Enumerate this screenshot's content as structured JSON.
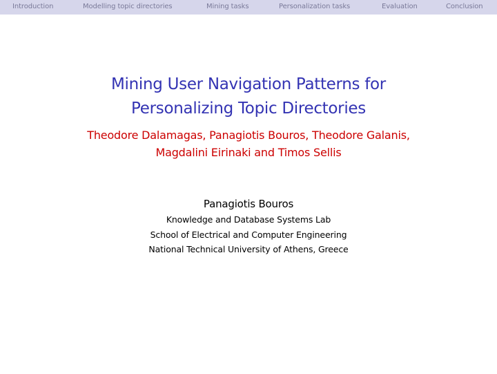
{
  "navigation": {
    "sections": [
      "Introduction",
      "Modelling topic directories",
      "Mining tasks",
      "Personalization tasks",
      "Evaluation",
      "Conclusion"
    ]
  },
  "slide": {
    "title_lines": [
      "Mining User Navigation Patterns for",
      "Personalizing Topic Directories"
    ],
    "author_lines": [
      "Theodore Dalamagas, Panagiotis Bouros, Theodore Galanis,",
      "Magdalini Eirinaki and Timos Sellis"
    ],
    "presenter": "Panagiotis Bouros",
    "affiliation_lines": [
      "Knowledge and Database Systems Lab",
      "School of Electrical and Computer Engineering",
      "National Technical University of Athens, Greece"
    ]
  },
  "colors": {
    "title": "#3333b3",
    "authors": "#cc0000",
    "navbar_background": "#d6d6eb",
    "navbar_text": "#7a7a99"
  }
}
